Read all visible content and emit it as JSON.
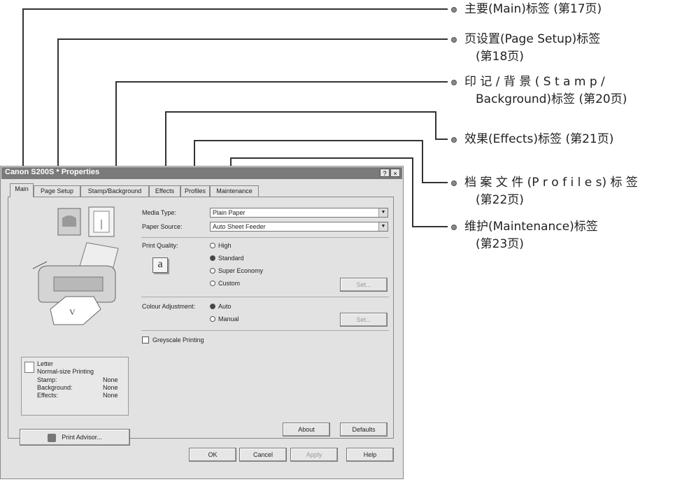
{
  "annotations": [
    {
      "text_line1": "主要(Main)标签 (第17页)",
      "text_line2": ""
    },
    {
      "text_line1": "页设置(Page Setup)标签",
      "text_line2": "(第18页)"
    },
    {
      "text_line1": "印 记 / 背 景 ( S t a m p /",
      "text_line2": "Background)标签 (第20页)"
    },
    {
      "text_line1": "效果(Effects)标签 (第21页)",
      "text_line2": ""
    },
    {
      "text_line1": "档 案 文 件 (P r o f i l e s) 标 签",
      "text_line2": "(第22页)"
    },
    {
      "text_line1": "维护(Maintenance)标签",
      "text_line2": "(第23页)"
    }
  ],
  "dialog": {
    "title": "Canon S200S * Properties",
    "help_btn": "?",
    "close_btn": "×",
    "tabs": [
      "Main",
      "Page Setup",
      "Stamp/Background",
      "Effects",
      "Profiles",
      "Maintenance"
    ],
    "media_type_label": "Media Type:",
    "media_type_value": "Plain Paper",
    "paper_source_label": "Paper Source:",
    "paper_source_value": "Auto Sheet Feeder",
    "print_quality_label": "Print Quality:",
    "quality_options": [
      "High",
      "Standard",
      "Super Economy",
      "Custom"
    ],
    "quality_selected": "Standard",
    "quality_icon_text": "a",
    "set_button_1": "Set...",
    "colour_adjustment_label": "Colour Adjustment:",
    "colour_options": [
      "Auto",
      "Manual"
    ],
    "colour_selected": "Auto",
    "set_button_2": "Set...",
    "greyscale_label": "Greyscale Printing",
    "info": {
      "paper": "Letter",
      "mode": "Normal-size Printing",
      "rows": [
        {
          "k": "Stamp:",
          "v": "None"
        },
        {
          "k": "Background:",
          "v": "None"
        },
        {
          "k": "Effects:",
          "v": "None"
        }
      ]
    },
    "print_advisor": "Print Advisor...",
    "about_button": "About",
    "defaults_button": "Defaults",
    "ok_button": "OK",
    "cancel_button": "Cancel",
    "apply_button": "Apply",
    "help_button": "Help"
  }
}
